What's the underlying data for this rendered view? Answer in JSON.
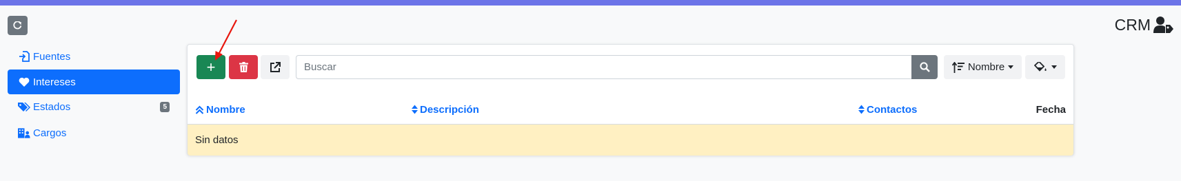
{
  "header": {
    "app_title": "CRM",
    "reload_icon": "reload-icon",
    "user_icon": "user-tag-icon"
  },
  "sidebar": {
    "items": [
      {
        "label": "Fuentes",
        "icon": "file-import-icon",
        "active": false
      },
      {
        "label": "Intereses",
        "icon": "heart-icon",
        "active": true
      },
      {
        "label": "Estados",
        "icon": "tags-icon",
        "active": false,
        "badge": "5"
      },
      {
        "label": "Cargos",
        "icon": "building-user-icon",
        "active": false
      }
    ]
  },
  "toolbar": {
    "add_label": "+",
    "search_placeholder": "Buscar",
    "search_value": "",
    "sort_label": "Nombre"
  },
  "table": {
    "columns": [
      {
        "label": "Nombre",
        "sort": "asc"
      },
      {
        "label": "Descripción",
        "sort": "both"
      },
      {
        "label": "Contactos",
        "sort": "both"
      },
      {
        "label": "Fecha",
        "sort": "none"
      }
    ],
    "empty_text": "Sin datos"
  },
  "colors": {
    "accent": "#0d6efd",
    "add": "#198754",
    "delete": "#dc3545",
    "secondary": "#6c757d",
    "empty_row": "#fff0c2",
    "annotation_arrow": "#e8170e"
  }
}
